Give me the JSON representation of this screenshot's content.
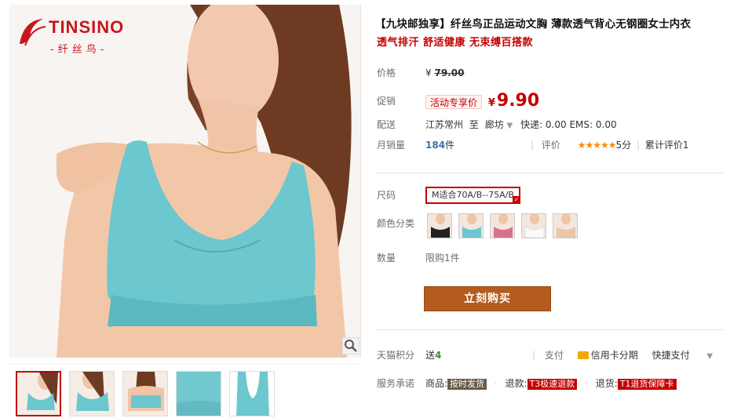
{
  "brand": {
    "name_en": "TINSINO",
    "name_cn": "-纤丝鸟-"
  },
  "product": {
    "title": "【九块邮独享】纤丝鸟正品运动文胸 薄款透气背心无钢圈女士内衣",
    "subtitle": "透气排汗 舒适健康 无束缚百搭款"
  },
  "price": {
    "label": "价格",
    "currency": "¥",
    "original": "79.00",
    "promo_label": "促销",
    "promo_tag": "活动专享价",
    "promo_price": "9.90"
  },
  "shipping": {
    "label": "配送",
    "from": "江苏常州",
    "to_word": "至",
    "to": "廊坊",
    "fees": "快递: 0.00 EMS: 0.00"
  },
  "sales": {
    "label": "月销量",
    "count": "184",
    "unit": "件",
    "rating_label": "评价",
    "stars": "★★★★★",
    "score": "5分",
    "review_text": "累计评价1"
  },
  "sku": {
    "size_label": "尺码",
    "size_selected": "M适合70A/B--75A/B",
    "color_label": "颜色分类",
    "colors": [
      "black",
      "blue",
      "pink",
      "white",
      "nude"
    ],
    "qty_label": "数量",
    "qty_limit": "限购1件"
  },
  "buy_button": "立刻购买",
  "points": {
    "label": "天猫积分",
    "send_word": "送",
    "value": "4",
    "pay_label": "支付",
    "credit": "信用卡分期",
    "fast_pay": "快捷支付"
  },
  "service": {
    "label": "服务承诺",
    "goods": "商品:",
    "goods_tag": "按时发货",
    "refund": "退款:",
    "refund_tag": "T3极速退款",
    "return": "退货:",
    "return_tag": "T1退货保障卡"
  },
  "colors": {
    "accent": "#c40000",
    "buy_button": "#b45b1f",
    "star": "#ff8a00"
  }
}
